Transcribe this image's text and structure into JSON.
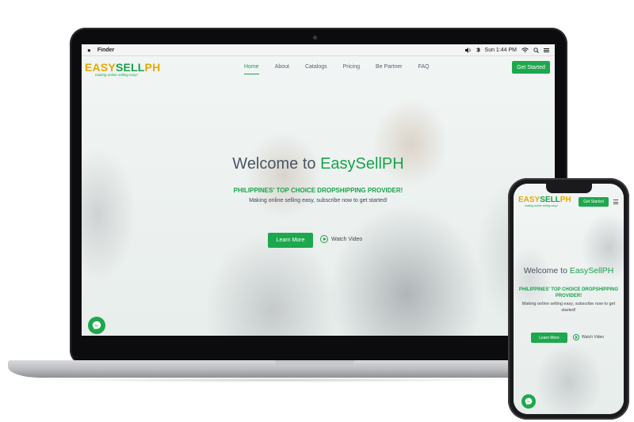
{
  "menubar": {
    "apple": "",
    "app": "Finder",
    "clock": "Sun 1:44 PM"
  },
  "site": {
    "logo_easy": "EASY",
    "logo_sell": "SELL",
    "logo_ph": "PH",
    "logo_tagline": "making online selling easy!",
    "nav": [
      "Home",
      "About",
      "Catalogs",
      "Pricing",
      "Be Partner",
      "FAQ"
    ],
    "cta": "Get Started",
    "hero_welcome": "Welcome to ",
    "hero_brand": "EasySellPH",
    "hero_sub": "PHILIPPINES' TOP CHOICE DROPSHIPPING PROVIDER!",
    "hero_desc": "Making online selling easy, subscribe now to get started!",
    "learn_more": "Learn More",
    "watch_video": "Watch Video"
  },
  "colors": {
    "brand_green": "#1ea84d",
    "brand_yellow": "#e5a900"
  },
  "icons": {
    "messenger": "messenger-icon",
    "play": "play-icon",
    "menu": "hamburger-menu-icon"
  }
}
